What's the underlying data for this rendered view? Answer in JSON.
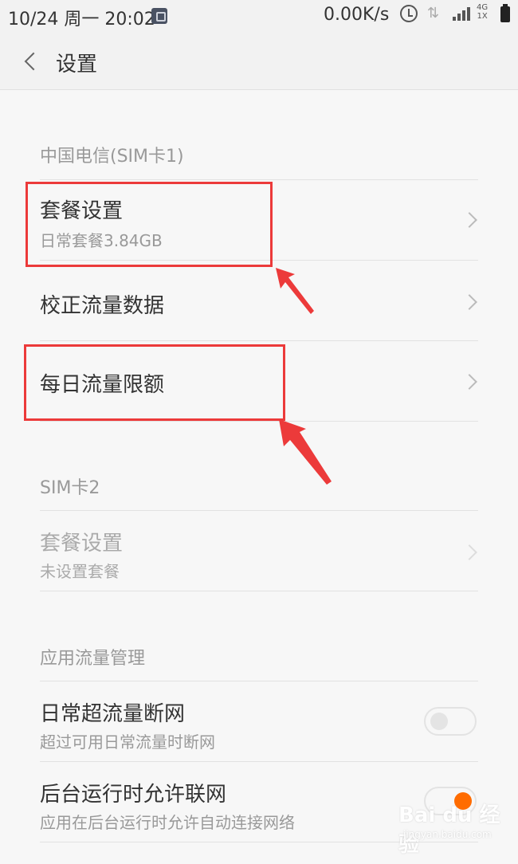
{
  "status_bar": {
    "datetime": "10/24 周一 20:02",
    "speed": "0.00K/s",
    "network_label_top": "4G",
    "network_label_bottom": "1X"
  },
  "header": {
    "title": "设置"
  },
  "sim1": {
    "section_label": "中国电信(SIM卡1)",
    "items": [
      {
        "title": "套餐设置",
        "subtitle": "日常套餐3.84GB"
      },
      {
        "title": "校正流量数据"
      },
      {
        "title": "每日流量限额"
      }
    ]
  },
  "sim2": {
    "section_label": "SIM卡2",
    "items": [
      {
        "title": "套餐设置",
        "subtitle": "未设置套餐"
      }
    ]
  },
  "app_traffic": {
    "section_label": "应用流量管理",
    "items": [
      {
        "title": "日常超流量断网",
        "subtitle": "超过可用日常流量时断网",
        "toggle": "off"
      },
      {
        "title": "后台运行时允许联网",
        "subtitle": "应用在后台运行时允许自动连接网络",
        "toggle": "on"
      }
    ]
  },
  "watermark": {
    "text": "Bai du 经验",
    "sub": "jingyan.baidu.com"
  },
  "colors": {
    "annotation": "#ec3a3a",
    "toggle_on": "#ff6c00"
  }
}
